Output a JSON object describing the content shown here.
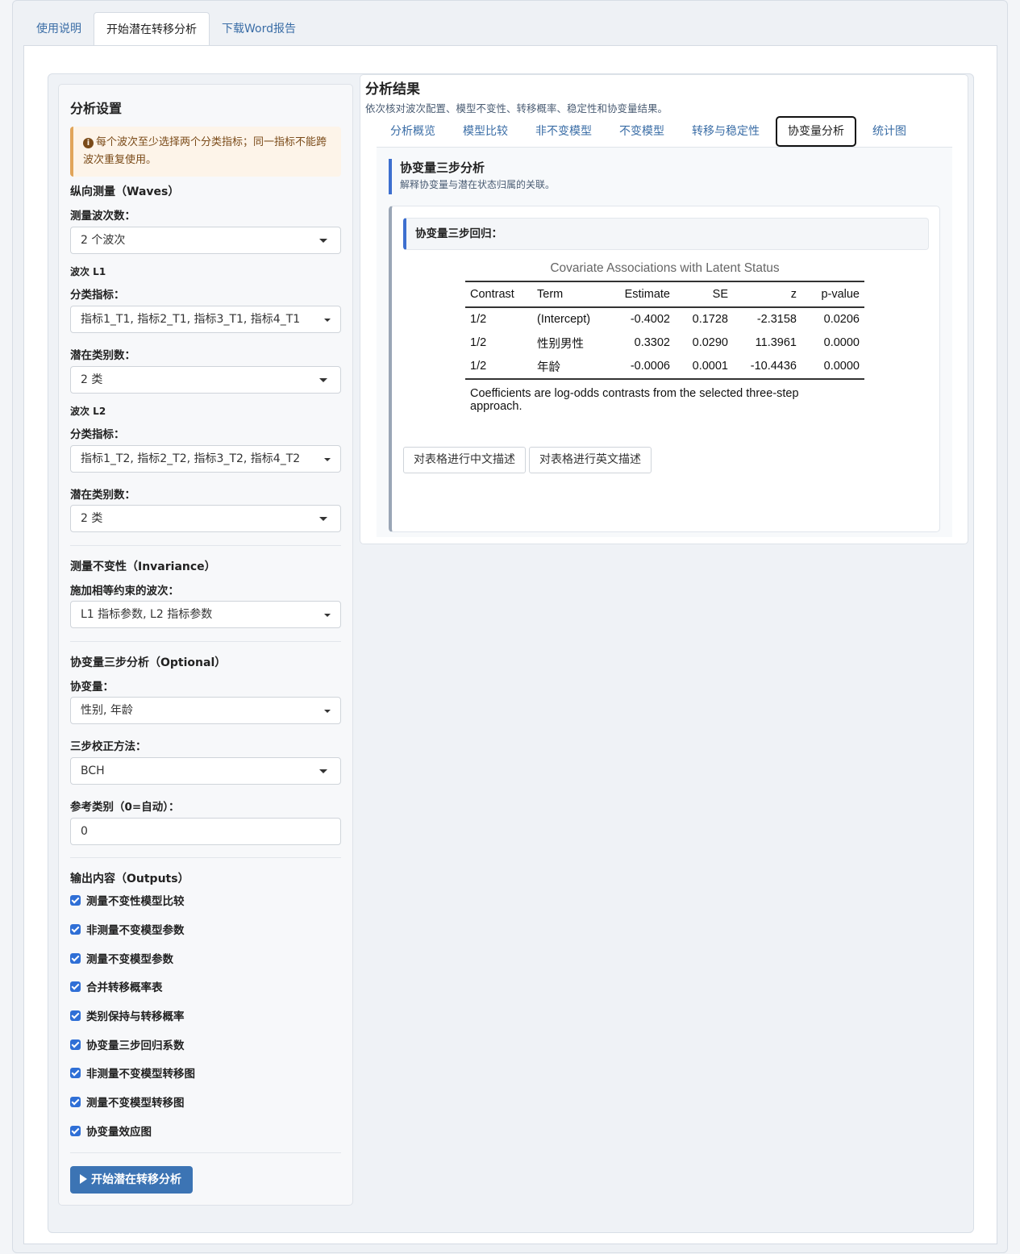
{
  "top_tabs": [
    "使用说明",
    "开始潜在转移分析",
    "下载Word报告"
  ],
  "sidebar": {
    "title": "分析设置",
    "alert": "每个波次至少选择两个分类指标；同一指标不能跨波次重复使用。",
    "waves_title": "纵向测量（Waves）",
    "waves_count_label": "测量波次数：",
    "waves_count_value": "2 个波次",
    "wave1_label": "波次 L1",
    "wave1_ind_label": "分类指标：",
    "wave1_ind_value": "指标1_T1, 指标2_T1, 指标3_T1, 指标4_T1",
    "wave1_k_label": "潜在类别数：",
    "wave1_k_value": "2 类",
    "wave2_label": "波次 L2",
    "wave2_ind_label": "分类指标：",
    "wave2_ind_value": "指标1_T2, 指标2_T2, 指标3_T2, 指标4_T2",
    "wave2_k_label": "潜在类别数：",
    "wave2_k_value": "2 类",
    "inv_title": "测量不变性（Invariance）",
    "inv_label": "施加相等约束的波次：",
    "inv_value": "L1 指标参数, L2 指标参数",
    "cov_title": "协变量三步分析（Optional）",
    "cov_label": "协变量：",
    "cov_value": "性别, 年龄",
    "method_label": "三步校正方法：",
    "method_value": "BCH",
    "ref_label": "参考类别（0=自动）：",
    "ref_value": "0",
    "out_title": "输出内容（Outputs）",
    "outputs": [
      "测量不变性模型比较",
      "非测量不变模型参数",
      "测量不变模型参数",
      "合并转移概率表",
      "类别保持与转移概率",
      "协变量三步回归系数",
      "非测量不变模型转移图",
      "测量不变模型转移图",
      "协变量效应图"
    ],
    "run_label": "开始潜在转移分析"
  },
  "main": {
    "title": "分析结果",
    "subtitle": "依次核对波次配置、模型不变性、转移概率、稳定性和协变量结果。",
    "tabs": [
      "分析概览",
      "模型比较",
      "非不变模型",
      "不变模型",
      "转移与稳定性",
      "协变量分析",
      "统计图"
    ],
    "section_title": "协变量三步分析",
    "section_sub": "解释协变量与潜在状态归属的关联。",
    "card_title": "协变量三步回归：",
    "table": {
      "caption": "Covariate Associations with Latent Status",
      "headers": [
        "Contrast",
        "Term",
        "Estimate",
        "SE",
        "z",
        "p-value"
      ],
      "rows": [
        [
          "1/2",
          "(Intercept)",
          "-0.4002",
          "0.1728",
          "-2.3158",
          "0.0206"
        ],
        [
          "1/2",
          "性别男性",
          "0.3302",
          "0.0290",
          "11.3961",
          "0.0000"
        ],
        [
          "1/2",
          "年龄",
          "-0.0006",
          "0.0001",
          "-10.4436",
          "0.0000"
        ]
      ],
      "note": "Coefficients are log-odds contrasts from the selected three-step approach."
    },
    "btn_cn": "对表格进行中文描述",
    "btn_en": "对表格进行英文描述"
  }
}
